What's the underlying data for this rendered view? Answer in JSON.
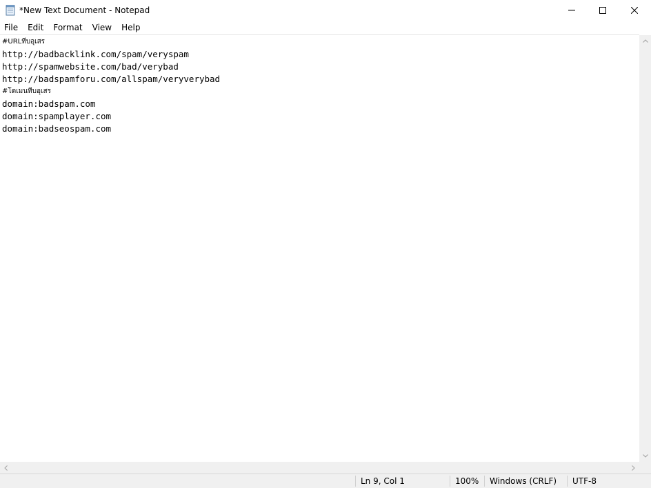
{
  "window": {
    "title": "*New Text Document - Notepad",
    "icon": "notepad-icon",
    "controls": [
      "minimize-icon",
      "maximize-icon",
      "close-icon"
    ]
  },
  "menu": {
    "file": "File",
    "edit": "Edit",
    "format": "Format",
    "view": "View",
    "help": "Help"
  },
  "document": {
    "lines": [
      "#URLทีบอุเสร",
      "http://badbacklink.com/spam/veryspam",
      "http://spamwebsite.com/bad/verybad",
      "http://badspamforu.com/allspam/veryverybad",
      "#โดเมนทีบอุเสร",
      "domain:badspam.com",
      "domain:spamplayer.com",
      "domain:badseospam.com"
    ]
  },
  "status": {
    "position": "Ln 9, Col 1",
    "zoom": "100%",
    "line_ending": "Windows (CRLF)",
    "encoding": "UTF-8"
  },
  "colors": {
    "background": "#ffffff",
    "chrome": "#f0f0f0"
  }
}
